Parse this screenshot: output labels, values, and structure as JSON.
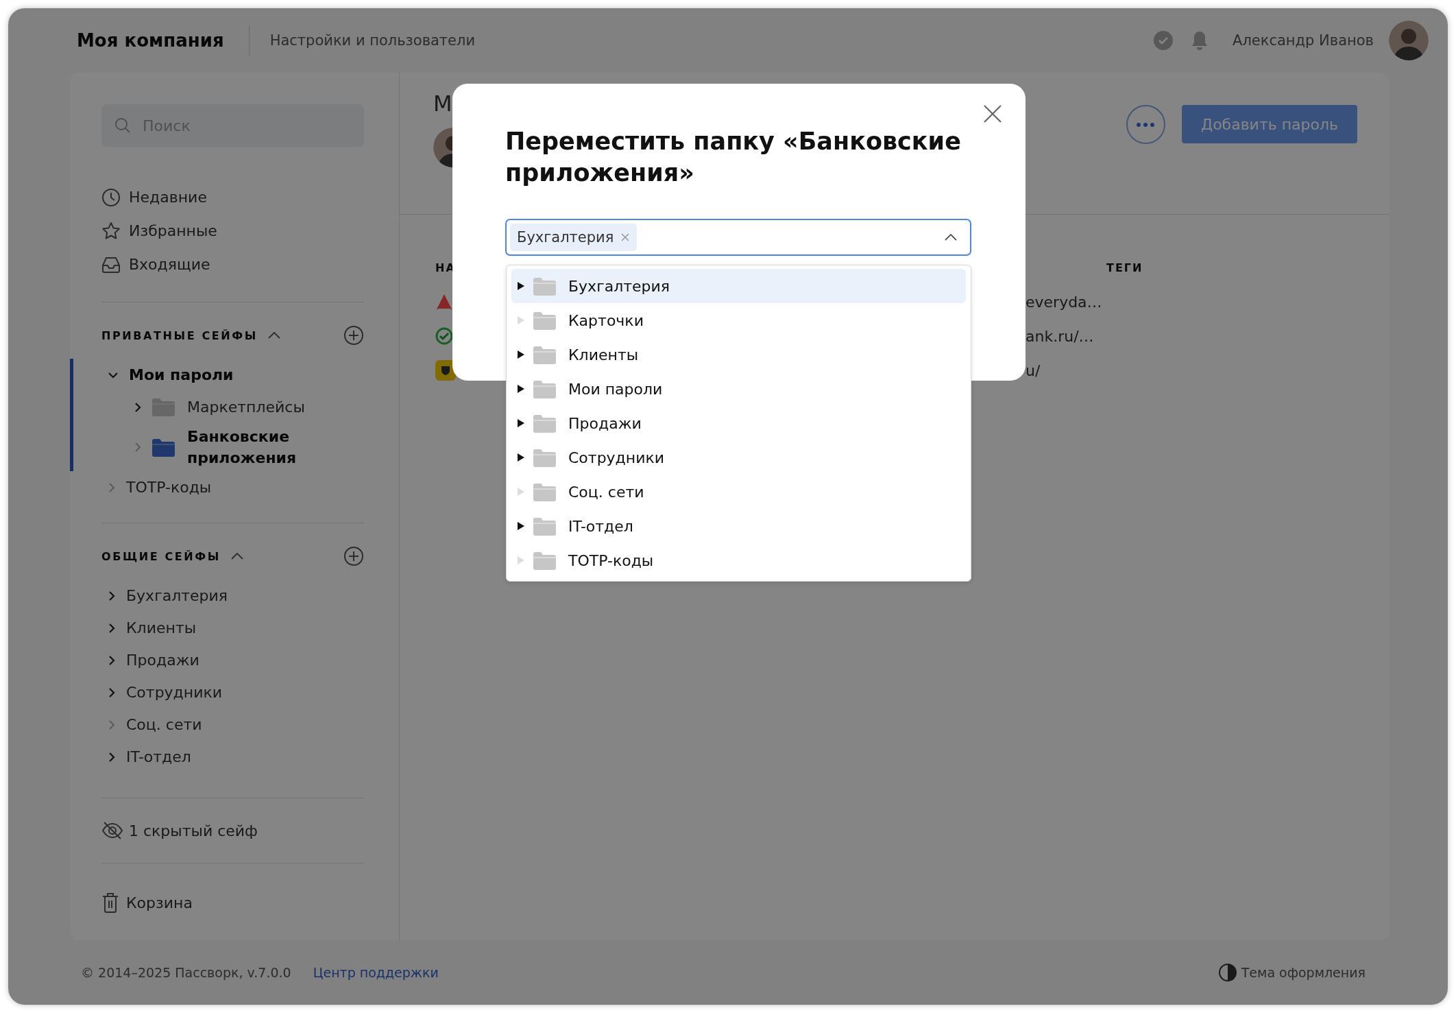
{
  "header": {
    "company": "Моя компания",
    "section": "Настройки и пользователи",
    "user": "Александр Иванов"
  },
  "sidebar": {
    "search": {
      "placeholder": "Поиск"
    },
    "nav": [
      {
        "kind": "recent",
        "label": "Недавние"
      },
      {
        "kind": "favorites",
        "label": "Избранные"
      },
      {
        "kind": "inbox",
        "label": "Входящие"
      }
    ],
    "private_vaults": {
      "title": "ПРИВАТНЫЕ СЕЙФЫ",
      "expanded": true,
      "items": [
        {
          "label": "Мои пароли",
          "selected": true,
          "expanded": true,
          "children": [
            {
              "label": "Маркетплейсы",
              "selected": false,
              "has_children": true
            },
            {
              "label": "Банковские приложения",
              "selected": true,
              "has_children": false
            }
          ]
        },
        {
          "label": "TOTP-коды",
          "selected": false,
          "expanded": false,
          "has_children": false
        }
      ]
    },
    "shared_vaults": {
      "title": "ОБЩИЕ СЕЙФЫ",
      "expanded": true,
      "items": [
        {
          "label": "Бухгалтерия",
          "selected": false,
          "expanded": false,
          "has_children": true
        },
        {
          "label": "Клиенты",
          "selected": false,
          "expanded": false,
          "has_children": true
        },
        {
          "label": "Продажи",
          "selected": false,
          "expanded": false,
          "has_children": true
        },
        {
          "label": "Сотрудники",
          "selected": false,
          "expanded": false,
          "has_children": true
        },
        {
          "label": "Соц. сети",
          "selected": false,
          "expanded": false,
          "has_children": false
        },
        {
          "label": "IT-отдел",
          "selected": false,
          "expanded": false,
          "has_children": true
        }
      ]
    },
    "hidden_vaults": "1 скрытый сейф",
    "trash": "Корзина"
  },
  "content": {
    "title": "М",
    "add_button": "Добавить пароль",
    "table": {
      "columns": [
        {
          "label": "НА"
        },
        {
          "label": "ТЕГИ"
        }
      ],
      "rows": [
        {
          "kind": "triangle",
          "url": "everyda…"
        },
        {
          "kind": "check",
          "url": "ank.ru/…"
        },
        {
          "kind": "shield",
          "url": "u/"
        }
      ]
    }
  },
  "modal": {
    "title": "Переместить папку «Банковские приложения»",
    "select": {
      "tags": [
        "Бухгалтерия"
      ],
      "expanded": true
    },
    "options": [
      {
        "label": "Бухгалтерия",
        "selected": true,
        "has_children": true
      },
      {
        "label": "Карточки",
        "selected": false,
        "has_children": false
      },
      {
        "label": "Клиенты",
        "selected": false,
        "has_children": true
      },
      {
        "label": "Мои пароли",
        "selected": false,
        "has_children": true
      },
      {
        "label": "Продажи",
        "selected": false,
        "has_children": true
      },
      {
        "label": "Сотрудники",
        "selected": false,
        "has_children": true
      },
      {
        "label": "Соц. сети",
        "selected": false,
        "has_children": false
      },
      {
        "label": "IT-отдел",
        "selected": false,
        "has_children": true
      },
      {
        "label": "TOTP-коды",
        "selected": false,
        "has_children": false
      }
    ]
  },
  "footer": {
    "copyright": "© 2014–2025 Пассворк, v.7.0.0",
    "support_link": "Центр поддержки",
    "theme": "Тема оформления"
  }
}
